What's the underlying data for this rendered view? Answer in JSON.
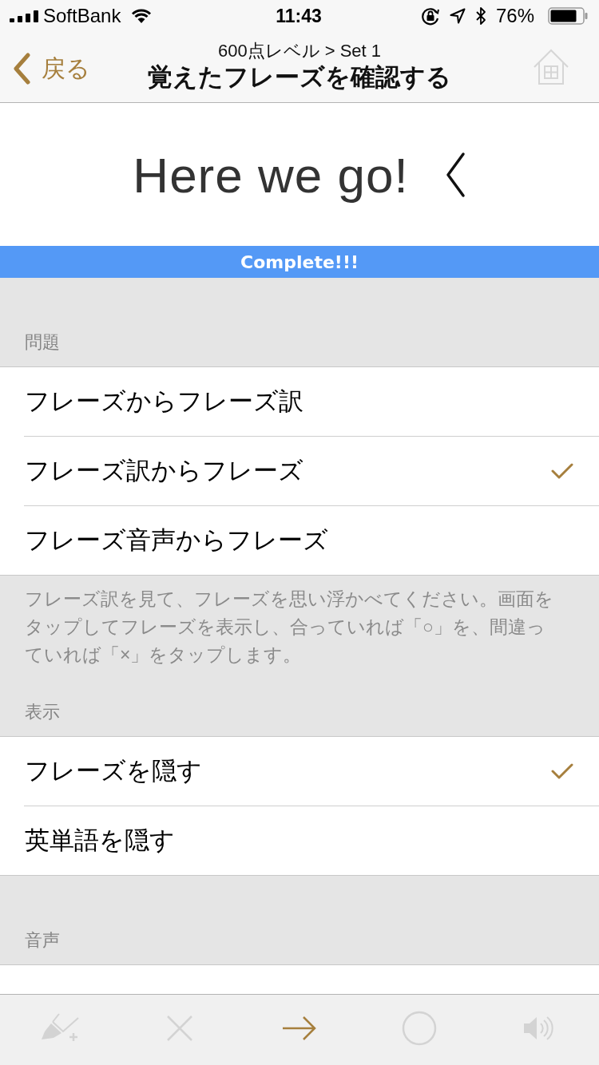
{
  "status_bar": {
    "carrier": "SoftBank",
    "time": "11:43",
    "battery": "76%"
  },
  "nav": {
    "back": "戻る",
    "subtitle": "600点レベル > Set 1",
    "title": "覚えたフレーズを確認する",
    "home": {
      "disabled": true
    }
  },
  "card": {
    "phrase": "Here we go!"
  },
  "banner": {
    "text": "Complete!!!"
  },
  "sections": [
    {
      "header": "問題",
      "items": [
        {
          "label": "フレーズからフレーズ訳",
          "selected": false
        },
        {
          "label": "フレーズ訳からフレーズ",
          "selected": true
        },
        {
          "label": "フレーズ音声からフレーズ",
          "selected": false
        }
      ],
      "footer": "フレーズ訳を見て、フレーズを思い浮かべてください。画面をタップしてフレーズを表示し、合っていれば「○」を、間違っていれば「×」をタップします。"
    },
    {
      "header": "表示",
      "items": [
        {
          "label": "フレーズを隠す",
          "checked": true
        },
        {
          "label": "英単語を隠す",
          "checked": false
        }
      ]
    },
    {
      "header": "音声"
    }
  ],
  "toolbar": [
    {
      "kind": "brush",
      "disabled": true
    },
    {
      "kind": "cross",
      "disabled": true
    },
    {
      "kind": "arrow",
      "disabled": false
    },
    {
      "kind": "circle",
      "disabled": true
    },
    {
      "kind": "speaker",
      "disabled": true
    }
  ]
}
